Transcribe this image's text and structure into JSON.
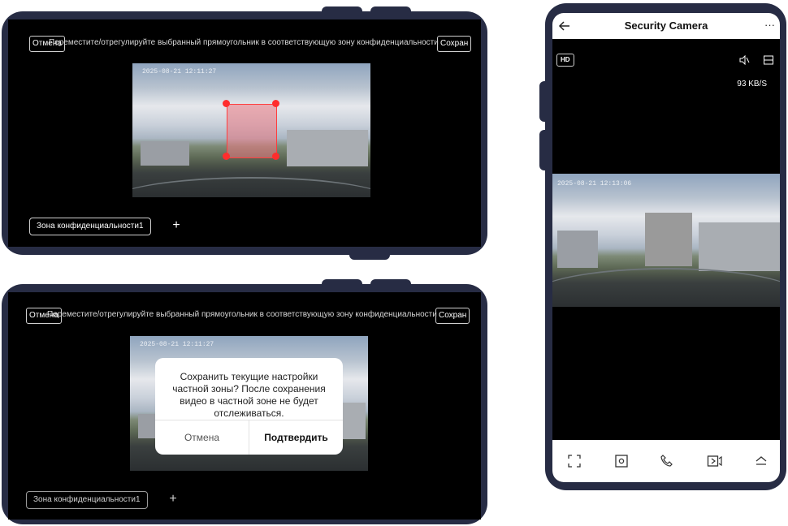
{
  "panel_top": {
    "cancel_label": "Отмена",
    "instruction": "Переместите/отрегулируйте выбранный прямоугольник в соответствующую зону конфиденциальности",
    "save_label": "Сохран",
    "timestamp": "2025-08-21 12:11:27",
    "zone_chip": "Зона конфиденциальности1",
    "add_label": "+"
  },
  "panel_bottom": {
    "cancel_label": "Отмена",
    "instruction": "Переместите/отрегулируйте выбранный прямоугольник в соответствующую зону конфиденциальности",
    "save_label": "Сохран",
    "timestamp": "2025-08-21 12:11:27",
    "zone_chip": "Зона конфиденциальности1",
    "add_label": "+",
    "dialog": {
      "message": "Сохранить текущие настройки частной зоны? После сохранения видео в частной зоне не будет отслеживаться.",
      "cancel": "Отмена",
      "confirm": "Подтвердить"
    }
  },
  "phone": {
    "title": "Security Camera",
    "back_icon": "arrow-left-icon",
    "more_label": "···",
    "hd_label": "HD",
    "speed": "93 KB/S",
    "timestamp": "2025-08-21 12:13:06",
    "toolbar_icons": [
      "fullscreen-icon",
      "screenshot-icon",
      "call-icon",
      "record-icon",
      "expand-icon"
    ]
  },
  "colors": {
    "frame": "#272c44",
    "screen": "#000000",
    "privacy_fill": "#eb7882",
    "handle": "#ff2d2d",
    "mask": "#9a9a9a"
  }
}
